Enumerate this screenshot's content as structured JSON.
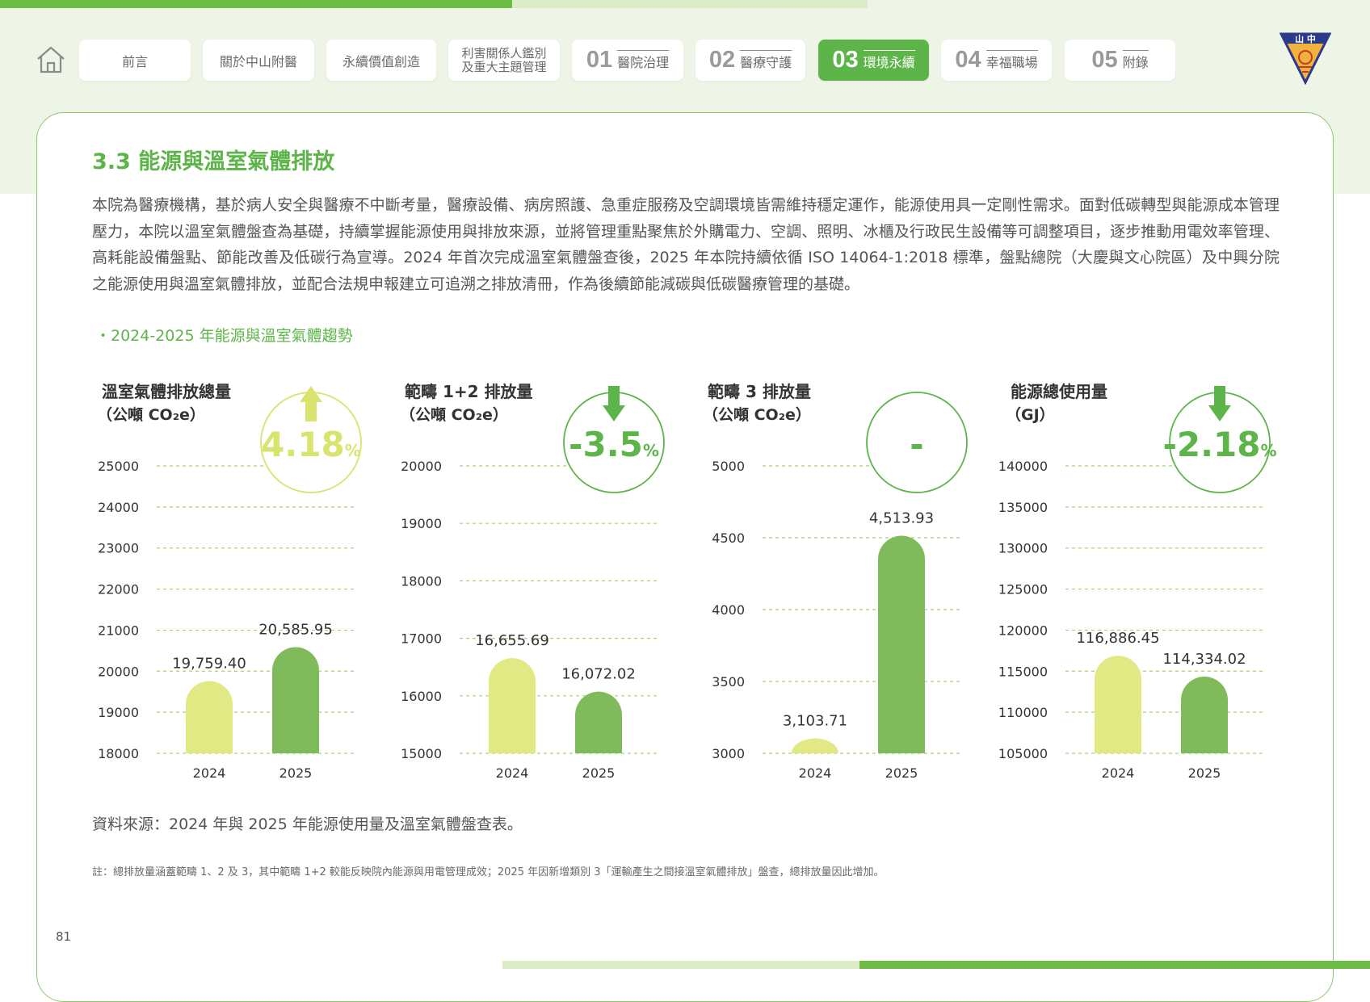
{
  "nav": {
    "tabs": [
      {
        "label": "前言"
      },
      {
        "label": "關於中山附醫"
      },
      {
        "label": "永續價值創造"
      },
      {
        "label_line1": "利害關係人鑑別",
        "label_line2": "及重大主題管理"
      },
      {
        "num": "01",
        "label": "醫院治理"
      },
      {
        "num": "02",
        "label": "醫療守護"
      },
      {
        "num": "03",
        "label": "環境永續"
      },
      {
        "num": "04",
        "label": "幸福職場"
      },
      {
        "num": "05",
        "label": "附錄"
      }
    ],
    "logo_text": "山 中"
  },
  "section": {
    "title": "3.3 能源與溫室氣體排放",
    "intro": "本院為醫療機構，基於病人安全與醫療不中斷考量，醫療設備、病房照護、急重症服務及空調環境皆需維持穩定運作，能源使用具一定剛性需求。面對低碳轉型與能源成本管理壓力，本院以溫室氣體盤查為基礎，持續掌握能源使用與排放來源，並將管理重點聚焦於外購電力、空調、照明、冰櫃及行政民生設備等可調整項目，逐步推動用電效率管理、高耗能設備盤點、節能改善及低碳行為宣導。2024 年首次完成溫室氣體盤查後，2025 年本院持續依循 ISO 14064-1:2018 標準，盤點總院（大慶與文心院區）及中興分院之能源使用與溫室氣體排放，並配合法規申報建立可追溯之排放清冊，作為後續節能減碳與低碳醫療管理的基礎。",
    "subheading": "・2024-2025 年能源與溫室氣體趨勢"
  },
  "colors": {
    "accent": "#5db54a",
    "bar_2024": "#e1e984",
    "bar_2025": "#80bb5b",
    "up_arrow": "#d8e370",
    "down_arrow": "#5db54a"
  },
  "chart_data": [
    {
      "type": "bar",
      "title_line1": "溫室氣體排放總量",
      "title_line2": "（公噸 CO₂e）",
      "categories": [
        "2024",
        "2025"
      ],
      "values": [
        19759.4,
        20585.95
      ],
      "value_labels": [
        "19,759.40",
        "20,585.95"
      ],
      "ylim": [
        18000,
        25000
      ],
      "yticks": [
        18000,
        19000,
        20000,
        21000,
        22000,
        23000,
        24000,
        25000
      ],
      "change": "4.18",
      "change_unit": "%",
      "direction": "up"
    },
    {
      "type": "bar",
      "title_line1": "範疇 1+2 排放量",
      "title_line2": "（公噸 CO₂e）",
      "categories": [
        "2024",
        "2025"
      ],
      "values": [
        16655.69,
        16072.02
      ],
      "value_labels": [
        "16,655.69",
        "16,072.02"
      ],
      "ylim": [
        15000,
        20000
      ],
      "yticks": [
        15000,
        16000,
        17000,
        18000,
        19000,
        20000
      ],
      "change": "-3.5",
      "change_unit": "%",
      "direction": "down"
    },
    {
      "type": "bar",
      "title_line1": "範疇 3 排放量",
      "title_line2": "（公噸 CO₂e）",
      "categories": [
        "2024",
        "2025"
      ],
      "values": [
        3103.71,
        4513.93
      ],
      "value_labels": [
        "3,103.71",
        "4,513.93"
      ],
      "ylim": [
        3000,
        5000
      ],
      "yticks": [
        3000,
        3500,
        4000,
        4500,
        5000
      ],
      "change": "-",
      "change_unit": "",
      "direction": "none"
    },
    {
      "type": "bar",
      "title_line1": "能源總使用量",
      "title_line2": "（GJ）",
      "categories": [
        "2024",
        "2025"
      ],
      "values": [
        116886.45,
        114334.02
      ],
      "value_labels": [
        "116,886.45",
        "114,334.02"
      ],
      "ylim": [
        105000,
        140000
      ],
      "yticks": [
        105000,
        110000,
        115000,
        120000,
        125000,
        130000,
        135000,
        140000
      ],
      "change": "-2.18",
      "change_unit": "%",
      "direction": "down"
    }
  ],
  "footer": {
    "source": "資料來源：2024 年與 2025 年能源使用量及溫室氣體盤查表。",
    "note": "註：總排放量涵蓋範疇 1、2 及 3，其中範疇 1+2 較能反映院內能源與用電管理成效；2025 年因新增類別 3「運輸產生之間接溫室氣體排放」盤查，總排放量因此增加。",
    "page_number": "81"
  }
}
